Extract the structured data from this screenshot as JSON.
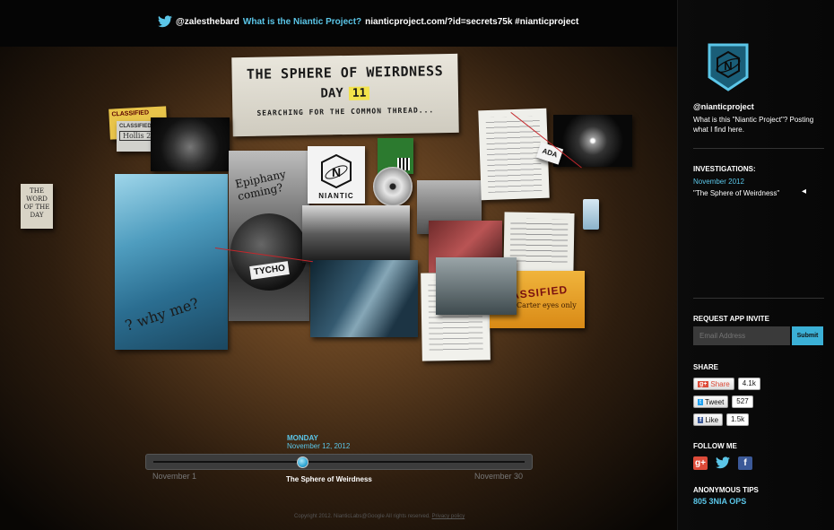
{
  "tweet": {
    "handle": "@zalesthebard",
    "question": "What is the Niantic Project?",
    "rest": "nianticproject.com/?id=secrets75k #nianticproject"
  },
  "board": {
    "title_line1": "THE SPHERE OF WEIRDNESS",
    "title_day_prefix": "DAY",
    "title_day_num": "11",
    "title_line3": "SEARCHING FOR THE COMMON THREAD...",
    "word_of_day": "THE WORD OF THE DAY",
    "classified_yellow": "CLASSIFIED",
    "classified_grey": "CLASSIFIED",
    "classified_grey_hand": "Hollis 2",
    "epiphany": "Epiphany coming?",
    "tycho": "TYCHO",
    "niantic": "NIANTIC",
    "why_note": "? why me?",
    "ada": "ADA",
    "classified_orange": "CLASSIFIED",
    "classified_orange_hand": "Carter eyes only"
  },
  "timeline": {
    "day": "MONDAY",
    "date": "November 12, 2012",
    "start": "November 1",
    "end": "November 30",
    "current": "The Sphere of Weirdness",
    "position": 0.4
  },
  "footer": {
    "copyright": "Copyright 2012. NianticLabs@Google All rights reserved.",
    "privacy": "Privacy policy"
  },
  "sidebar": {
    "handle": "@nianticproject",
    "desc": "What is this \"Niantic Project\"? Posting what I find here.",
    "investigations_head": "INVESTIGATIONS:",
    "month": "November 2012",
    "investigation": "\"The Sphere of Weirdness\"",
    "request_head": "REQUEST APP INVITE",
    "email_placeholder": "Email Address",
    "submit": "Submit",
    "share_head": "SHARE",
    "gplus_label": "Share",
    "gplus_count": "4.1k",
    "tweet_label": "Tweet",
    "tweet_count": "527",
    "like_label": "Like",
    "like_count": "1.5k",
    "follow_head": "FOLLOW ME",
    "tips_head": "ANONYMOUS TIPS",
    "phone": "805 3NIA OPS"
  },
  "colors": {
    "accent": "#5bc6e8",
    "red_string": "#c4262b"
  }
}
